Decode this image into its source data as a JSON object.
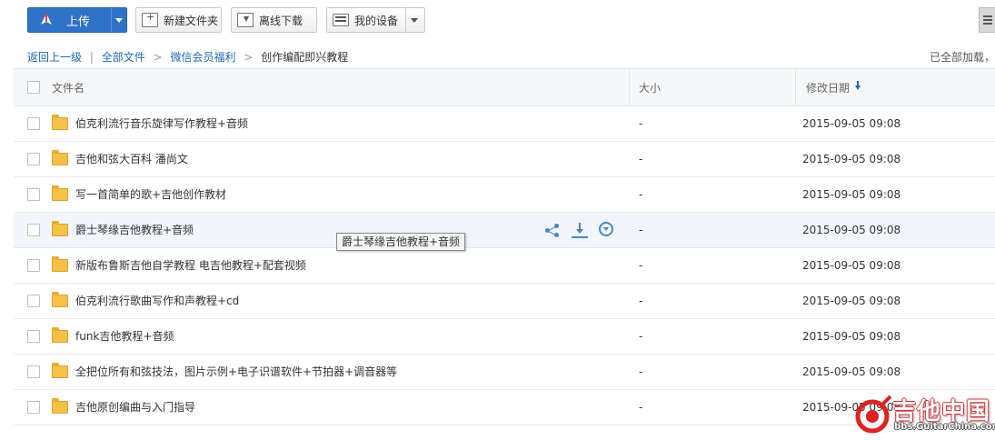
{
  "toolbar": {
    "upload_label": "上传",
    "new_folder_label": "新建文件夹",
    "offline_download_label": "离线下载",
    "my_devices_label": "我的设备"
  },
  "breadcrumb": {
    "back": "返回上一级",
    "all_files": "全部文件",
    "folder": "微信会员福利",
    "current": "创作编配即兴教程",
    "divider": "|",
    "arrow": ">"
  },
  "loaded_note": "已全部加载，",
  "table": {
    "headers": {
      "name": "文件名",
      "size": "大小",
      "modified": "修改日期"
    },
    "rows": [
      {
        "name": "伯克利流行音乐旋律写作教程+音频",
        "size": "-",
        "date": "2015-09-05 09:08"
      },
      {
        "name": "吉他和弦大百科 潘尚文",
        "size": "-",
        "date": "2015-09-05 09:08"
      },
      {
        "name": "写一首简单的歌+吉他创作教材",
        "size": "-",
        "date": "2015-09-05 09:08"
      },
      {
        "name": "爵士琴缘吉他教程+音频",
        "size": "-",
        "date": "2015-09-05 09:08"
      },
      {
        "name": "新版布鲁斯吉他自学教程 电吉他教程+配套视频",
        "size": "-",
        "date": "2015-09-05 09:08"
      },
      {
        "name": "伯克利流行歌曲写作和声教程+cd",
        "size": "-",
        "date": "2015-09-05 09:08"
      },
      {
        "name": "funk吉他教程+音频",
        "size": "-",
        "date": "2015-09-05 09:08"
      },
      {
        "name": "全把位所有和弦技法，图片示例+电子识谱软件+节拍器+调音器等",
        "size": "-",
        "date": "2015-09-05 09:08"
      },
      {
        "name": "吉他原创编曲与入门指导",
        "size": "-",
        "date": "2015-09-05 09:08"
      }
    ]
  },
  "tooltip": "爵士琴缘吉他教程+音频",
  "watermark": {
    "title": "吉他中国",
    "url": "bbs.GuitarChina.com"
  },
  "colors": {
    "accent": "#2f72c9",
    "link": "#1e68b8",
    "folder": "#f5c048",
    "hover_row": "#f2f6fc"
  }
}
